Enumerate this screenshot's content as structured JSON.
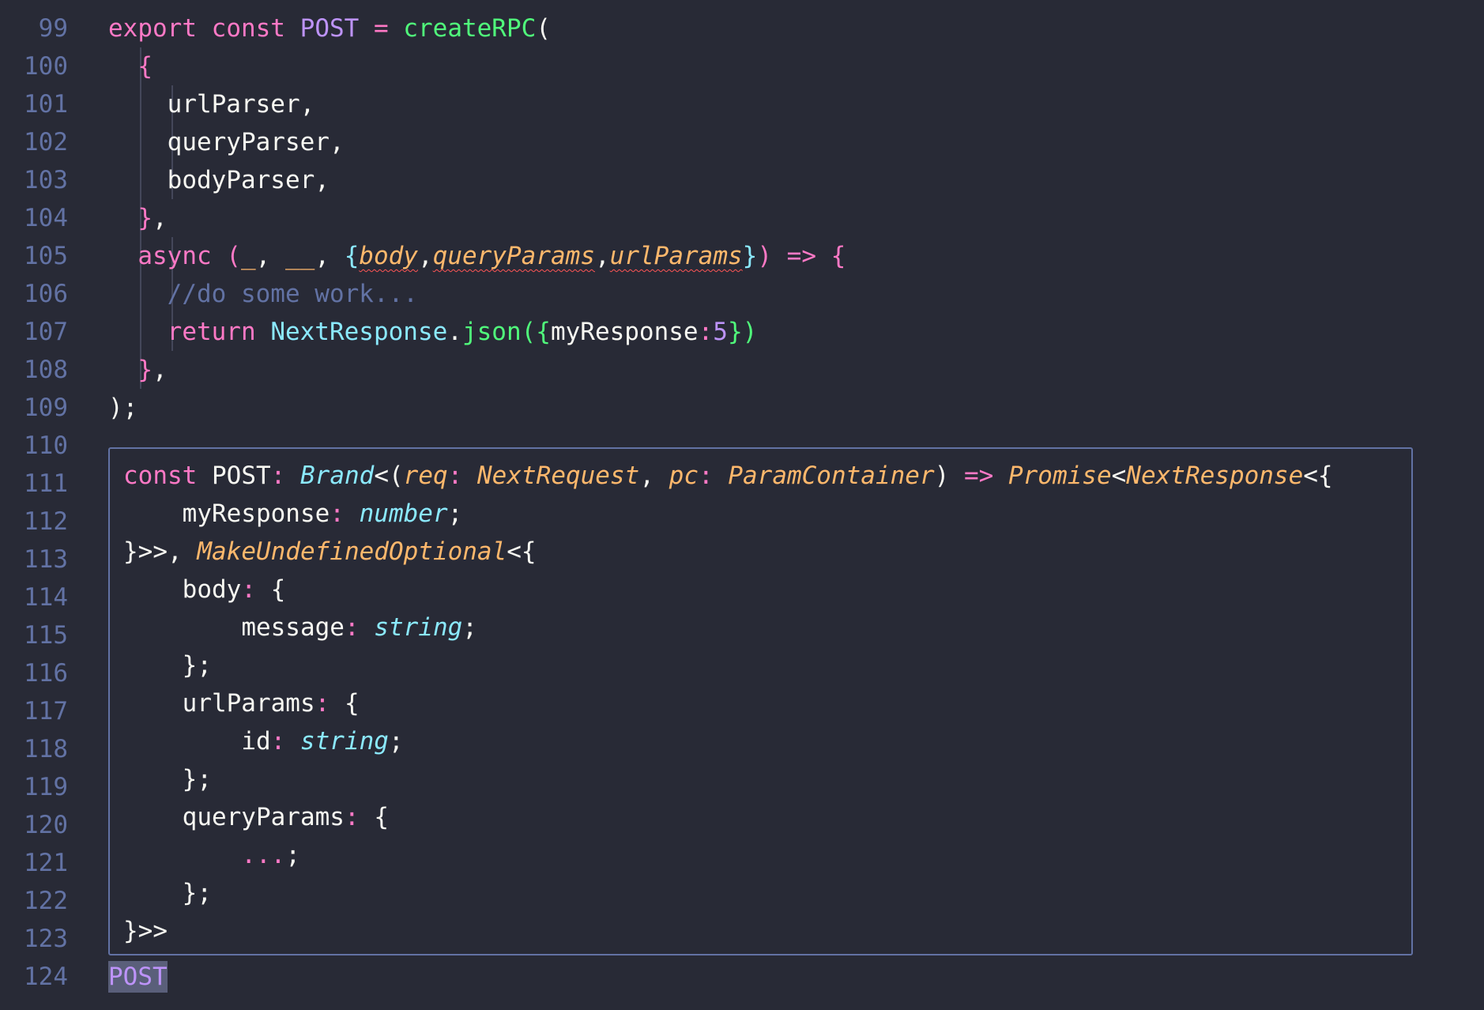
{
  "gutter": {
    "lines": [
      "99",
      "100",
      "101",
      "102",
      "103",
      "104",
      "105",
      "106",
      "107",
      "108",
      "109",
      "110",
      "111",
      "112",
      "113",
      "114",
      "115",
      "116",
      "117",
      "118",
      "119",
      "120",
      "121",
      "122",
      "123",
      "124"
    ]
  },
  "code": {
    "l99": {
      "export": "export",
      "const": "const",
      "name": "POST",
      "eq": "=",
      "fn": "createRPC",
      "paren": "("
    },
    "l100": {
      "brace": "{"
    },
    "l101": {
      "text": "urlParser,"
    },
    "l102": {
      "text": "queryParser,"
    },
    "l103": {
      "text": "bodyParser,"
    },
    "l104": {
      "brace": "}",
      "comma": ","
    },
    "l105": {
      "async": "async",
      "open": "(",
      "u1": "_",
      "c1": ",",
      "u2": "__",
      "c2": ",",
      "lb": "{",
      "body": "body",
      "c3": ",",
      "qp": "queryParams",
      "c4": ",",
      "up": "urlParams",
      "rb": "}",
      "close": ")",
      "arrow": "=>",
      "ob": "{"
    },
    "l106": {
      "comment": "//do some work..."
    },
    "l107": {
      "ret": "return",
      "cls": "NextResponse",
      "dot": ".",
      "fn": "json",
      "op": "(",
      "lb": "{",
      "key": "myResponse",
      "colon": ":",
      "num": "5",
      "rb": "}",
      "cp": ")"
    },
    "l108": {
      "brace": "}",
      "comma": ","
    },
    "l109": {
      "text": ");"
    }
  },
  "hover": {
    "h1": {
      "const": "const",
      "name": "POST",
      "colon": ":",
      "brand": "Brand",
      "lt": "<(",
      "req": "req",
      "c1": ":",
      "nextreq": "NextRequest",
      "comma": ",",
      "pc": "pc",
      "c2": ":",
      "paramc": "ParamContainer",
      "rp": ")",
      "arrow": "=>",
      "promise": "Promise",
      "lt2": "<",
      "nextres": "NextResponse",
      "lt3": "<{"
    },
    "h2": {
      "key": "myResponse",
      "colon": ":",
      "type": "number",
      "semi": ";"
    },
    "h3": {
      "close": "}>>,",
      "mk": "MakeUndefinedOptional",
      "open": "<{"
    },
    "h4": {
      "key": "body",
      "colon": ":",
      "brace": "{"
    },
    "h5": {
      "key": "message",
      "colon": ":",
      "type": "string",
      "semi": ";"
    },
    "h6": {
      "text": "};"
    },
    "h7": {
      "key": "urlParams",
      "colon": ":",
      "brace": "{"
    },
    "h8": {
      "key": "id",
      "colon": ":",
      "type": "string",
      "semi": ";"
    },
    "h9": {
      "text": "};"
    },
    "h10": {
      "key": "queryParams",
      "colon": ":",
      "brace": "{"
    },
    "h11": {
      "dots": "...",
      "semi": ";"
    },
    "h12": {
      "text": "};"
    },
    "h13": {
      "text": "}>>"
    }
  },
  "cursor_word": "POST",
  "colors": {
    "background": "#282a36",
    "keyword": "#ff79c6",
    "function": "#50fa7b",
    "purple": "#bd93f9",
    "cyan": "#8be9fd",
    "orange": "#ffb86c",
    "comment": "#6272a4",
    "error_underline": "#ff5555"
  }
}
